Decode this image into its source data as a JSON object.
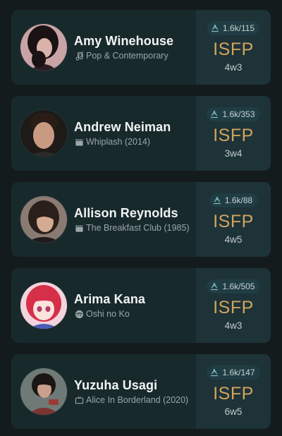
{
  "profiles": [
    {
      "name": "Amy Winehouse",
      "category_icon": "music-note-icon",
      "category": "Pop & Contemporary",
      "votes": "1.6k/115",
      "type": "ISFP",
      "enneagram": "4w3"
    },
    {
      "name": "Andrew Neiman",
      "category_icon": "film-clapper-icon",
      "category": "Whiplash (2014)",
      "votes": "1.6k/353",
      "type": "ISFP",
      "enneagram": "3w4"
    },
    {
      "name": "Allison Reynolds",
      "category_icon": "film-clapper-icon",
      "category": "The Breakfast Club (1985)",
      "votes": "1.6k/88",
      "type": "ISFP",
      "enneagram": "4w5"
    },
    {
      "name": "Arima Kana",
      "category_icon": "anime-icon",
      "category": "Oshi no Ko",
      "votes": "1.6k/505",
      "type": "ISFP",
      "enneagram": "4w3"
    },
    {
      "name": "Yuzuha Usagi",
      "category_icon": "tv-icon",
      "category": "Alice In Borderland (2020)",
      "votes": "1.6k/147",
      "type": "ISFP",
      "enneagram": "6w5"
    }
  ],
  "colors": {
    "background": "#141b1d",
    "card": "#18292c",
    "side_panel": "#1d3338",
    "type_accent": "#d3a35c"
  }
}
